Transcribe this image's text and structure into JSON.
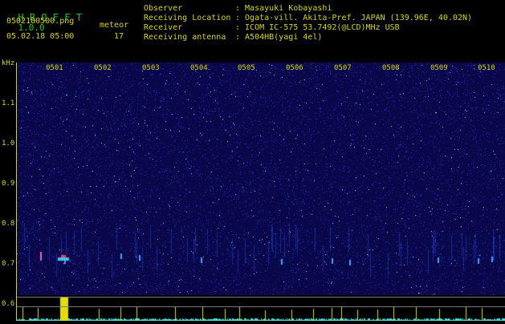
{
  "app": {
    "name": "H R O F F T",
    "version": "1.0.0"
  },
  "file_name": "0502180500.png",
  "date_time": "05.02.18 05:00",
  "meteor": {
    "label": "meteor",
    "count": "17"
  },
  "info": [
    {
      "key": "Observer",
      "value": ": Masayuki Kobayashi"
    },
    {
      "key": "Receiving Location",
      "value": ": Ogata-vill. Akita-Pref. JAPAN (139.96E, 40.02N)"
    },
    {
      "key": "Receiver",
      "value": ": ICOM IC-575 53.7492(@LCD)MHz USB"
    },
    {
      "key": "Receiving antenna",
      "value": ": A504HB(yagi 4el)"
    }
  ],
  "axis": {
    "unit": "kHz",
    "y_ticks": [
      "1.1",
      "1.0",
      "0.9",
      "0.8",
      "0.7",
      "0.6"
    ],
    "x_ticks": [
      "0501",
      "0502",
      "0503",
      "0504",
      "0505",
      "0506",
      "0507",
      "0508",
      "0509",
      "0510"
    ]
  },
  "colors": {
    "text": "#d8d800",
    "title": "#19c919",
    "background": "#000000",
    "noise": "#1a1aa0",
    "meter": "#40e0e0"
  }
}
